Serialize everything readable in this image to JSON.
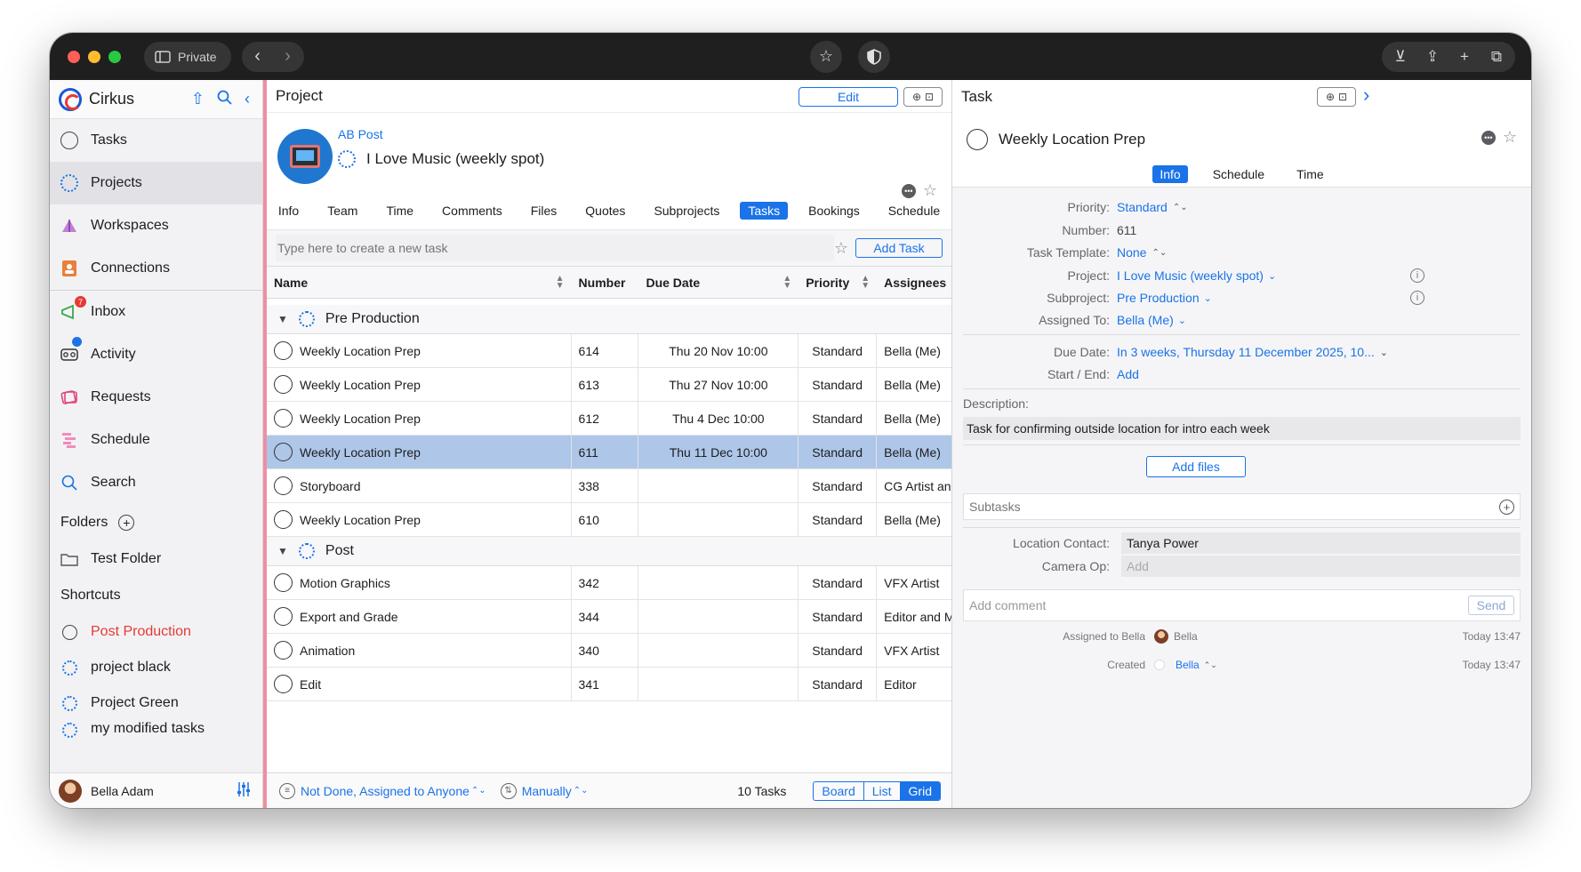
{
  "browser": {
    "private_label": "Private"
  },
  "sidebar": {
    "app_name": "Cirkus",
    "items": [
      {
        "label": "Tasks",
        "icon": "circle-icon"
      },
      {
        "label": "Projects",
        "icon": "dotted-circle-icon"
      },
      {
        "label": "Workspaces",
        "icon": "workspaces-icon"
      },
      {
        "label": "Connections",
        "icon": "contact-card-icon"
      }
    ],
    "items2": [
      {
        "label": "Inbox",
        "icon": "megaphone-icon",
        "badge": "7"
      },
      {
        "label": "Activity",
        "icon": "voicemail-icon"
      },
      {
        "label": "Requests",
        "icon": "tickets-icon"
      },
      {
        "label": "Schedule",
        "icon": "gantt-icon"
      },
      {
        "label": "Search",
        "icon": "search-icon"
      }
    ],
    "folders_label": "Folders",
    "folder": "Test Folder",
    "shortcuts_label": "Shortcuts",
    "shortcuts": [
      "Post Production",
      "project black",
      "Project Green",
      "my modified tasks"
    ],
    "user_name": "Bella Adam"
  },
  "project": {
    "header": "Project",
    "edit_label": "Edit",
    "client": "AB Post",
    "title": "I Love Music (weekly spot)",
    "tabs": [
      "Info",
      "Team",
      "Time",
      "Comments",
      "Files",
      "Quotes",
      "Subprojects",
      "Tasks",
      "Bookings",
      "Schedule"
    ],
    "active_tab": "Tasks",
    "new_task_placeholder": "Type here to create a new task",
    "add_task_label": "Add Task",
    "columns": [
      "Name",
      "Number",
      "Due Date",
      "Priority",
      "Assignees"
    ],
    "groups": [
      {
        "name": "Pre Production",
        "rows": [
          {
            "name": "Weekly Location Prep",
            "number": "614",
            "due": "Thu 20 Nov 10:00",
            "priority": "Standard",
            "assignees": "Bella (Me)"
          },
          {
            "name": "Weekly Location Prep",
            "number": "613",
            "due": "Thu 27 Nov 10:00",
            "priority": "Standard",
            "assignees": "Bella (Me)"
          },
          {
            "name": "Weekly Location Prep",
            "number": "612",
            "due": "Thu 4 Dec 10:00",
            "priority": "Standard",
            "assignees": "Bella (Me)"
          },
          {
            "name": "Weekly Location Prep",
            "number": "611",
            "due": "Thu 11 Dec 10:00",
            "priority": "Standard",
            "assignees": "Bella (Me)",
            "selected": true
          },
          {
            "name": "Storyboard",
            "number": "338",
            "due": "",
            "priority": "Standard",
            "assignees": "CG Artist and"
          },
          {
            "name": "Weekly Location Prep",
            "number": "610",
            "due": "",
            "priority": "Standard",
            "assignees": "Bella (Me)"
          }
        ]
      },
      {
        "name": "Post",
        "rows": [
          {
            "name": "Motion Graphics",
            "number": "342",
            "due": "",
            "priority": "Standard",
            "assignees": "VFX Artist"
          },
          {
            "name": "Export and Grade",
            "number": "344",
            "due": "",
            "priority": "Standard",
            "assignees": "Editor and MC"
          },
          {
            "name": "Animation",
            "number": "340",
            "due": "",
            "priority": "Standard",
            "assignees": "VFX Artist"
          },
          {
            "name": "Edit",
            "number": "341",
            "due": "",
            "priority": "Standard",
            "assignees": "Editor"
          }
        ]
      }
    ],
    "footer": {
      "filter": "Not Done, Assigned to Anyone",
      "sort": "Manually",
      "count": "10 Tasks",
      "views": [
        "Board",
        "List",
        "Grid"
      ],
      "active_view": "Grid"
    }
  },
  "task": {
    "header": "Task",
    "title": "Weekly Location Prep",
    "tabs": [
      "Info",
      "Schedule",
      "Time"
    ],
    "active_tab": "Info",
    "fields": {
      "priority_label": "Priority:",
      "priority": "Standard",
      "number_label": "Number:",
      "number": "611",
      "template_label": "Task Template:",
      "template": "None",
      "project_label": "Project:",
      "project": "I Love Music (weekly spot)",
      "subproject_label": "Subproject:",
      "subproject": "Pre Production",
      "assigned_label": "Assigned To:",
      "assigned": "Bella (Me)",
      "due_label": "Due Date:",
      "due": "In 3 weeks, Thursday 11 December 2025, 10...",
      "startend_label": "Start / End:",
      "startend": "Add"
    },
    "description_label": "Description:",
    "description": "Task for confirming outside location for intro each week",
    "add_files_label": "Add files",
    "subtasks_label": "Subtasks",
    "location_contact_label": "Location Contact:",
    "location_contact": "Tanya Power",
    "camera_op_label": "Camera Op:",
    "camera_op_placeholder": "Add",
    "comment_placeholder": "Add comment",
    "send_label": "Send",
    "history": [
      {
        "action": "Assigned to Bella",
        "who": "Bella",
        "time": "Today 13:47"
      },
      {
        "action": "Created",
        "who": "Bella",
        "time": "Today 13:47"
      }
    ]
  }
}
